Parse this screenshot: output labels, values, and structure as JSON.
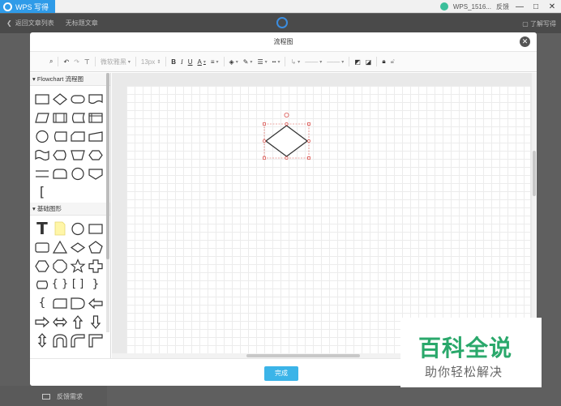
{
  "titlebar": {
    "app_name": "WPS 写得",
    "user": "WPS_1516...",
    "feedback": "反馈",
    "minimize": "—",
    "maximize": "□",
    "close": "✕"
  },
  "docbar": {
    "back_label": "返回文章列表",
    "doc_name": "无标题文章",
    "help_label": "了解写得"
  },
  "modal": {
    "title": "流程图",
    "close_icon": "close-icon",
    "done_label": "完成"
  },
  "toolbar": {
    "font_family": "微软雅黑",
    "font_size": "13px",
    "bold": "B",
    "italic": "I",
    "underline": "U",
    "font_color": "A"
  },
  "panel": {
    "section1": "▾ Flowchart 流程图",
    "section2": "▾ 基础图形",
    "bracket_glyph": "[",
    "text_glyph": "T"
  },
  "bottom": {
    "feedback_label": "反馈需求"
  },
  "watermark": {
    "big": "百科全说",
    "small": "助你轻松解决"
  },
  "colors": {
    "accent": "#3bb4e8",
    "app_blue": "#2f9be8",
    "watermark_green": "#2aa86b",
    "selection_red": "#d9534f"
  }
}
